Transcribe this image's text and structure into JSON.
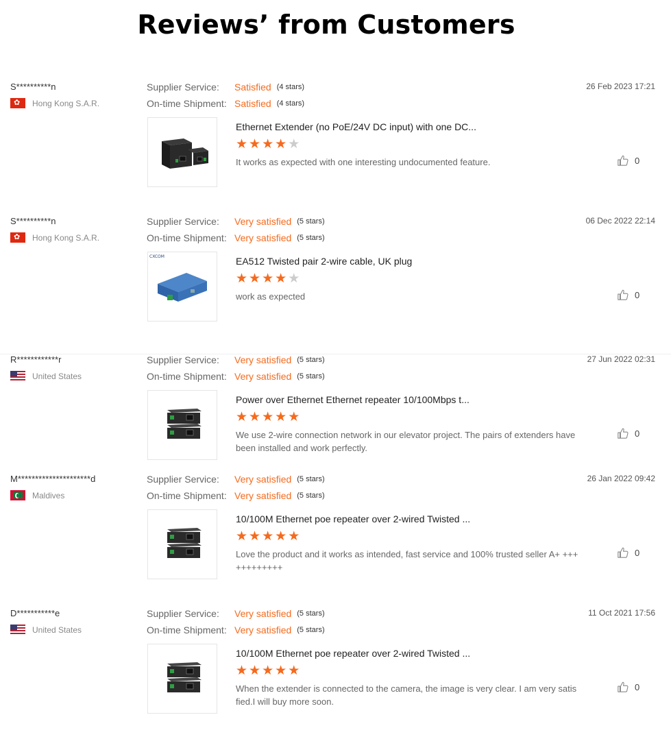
{
  "page_title": "Reviews’ from Customers",
  "labels": {
    "supplier_service": "Supplier Service:",
    "ontime_shipment": "On-time Shipment:"
  },
  "colors": {
    "accent": "#f56a1d",
    "star_off": "#cccccc"
  },
  "reviews": [
    {
      "buyer": "S**********n",
      "country": "Hong Kong S.A.R.",
      "flag_icon": "hong-kong-flag-icon",
      "supplier_service": {
        "value": "Satisfied",
        "stars": "(4 stars)"
      },
      "ontime_shipment": {
        "value": "Satisfied",
        "stars": "(4 stars)"
      },
      "date": "26 Feb 2023 17:21",
      "product_name": "Ethernet Extender (no PoE/24V DC input) with one DC...",
      "rating": 4,
      "comment": "It works as expected with one interesting undocumented feature.",
      "likes": "0",
      "image_icon": "ethernet-extender-image"
    },
    {
      "buyer": "S**********n",
      "country": "Hong Kong S.A.R.",
      "flag_icon": "hong-kong-flag-icon",
      "supplier_service": {
        "value": "Very satisfied",
        "stars": "(5 stars)"
      },
      "ontime_shipment": {
        "value": "Very satisfied",
        "stars": "(5 stars)"
      },
      "date": "06 Dec 2022 22:14",
      "product_name": "EA512 Twisted pair 2-wire cable, UK plug",
      "rating": 4,
      "comment": "work as expected",
      "likes": "0",
      "image_icon": "blue-extender-image",
      "image_brand": "CXCOM"
    },
    {
      "buyer": "R************r",
      "country": "United States",
      "flag_icon": "united-states-flag-icon",
      "supplier_service": {
        "value": "Very satisfied",
        "stars": "(5 stars)"
      },
      "ontime_shipment": {
        "value": "Very satisfied",
        "stars": "(5 stars)"
      },
      "date": "27 Jun 2022 02:31",
      "product_name": "Power over Ethernet Ethernet repeater 10/100Mbps t...",
      "rating": 5,
      "comment": "We use 2-wire connection network in our elevator project. The pairs of extenders have been installed and work perfectly.",
      "likes": "0",
      "image_icon": "stacked-repeater-image"
    },
    {
      "buyer": "M*********************d",
      "country": "Maldives",
      "flag_icon": "maldives-flag-icon",
      "supplier_service": {
        "value": "Very satisfied",
        "stars": "(5 stars)"
      },
      "ontime_shipment": {
        "value": "Very satisfied",
        "stars": "(5 stars)"
      },
      "date": "26 Jan 2022 09:42",
      "product_name": "10/100M Ethernet poe repeater over 2-wired Twisted ...",
      "rating": 5,
      "comment": "Love the product and it works as intended, fast service and 100% trusted seller A+ ++++++++++++",
      "likes": "0",
      "image_icon": "stacked-repeater-image"
    },
    {
      "buyer": "D***********e",
      "country": "United States",
      "flag_icon": "united-states-flag-icon",
      "supplier_service": {
        "value": "Very satisfied",
        "stars": "(5 stars)"
      },
      "ontime_shipment": {
        "value": "Very satisfied",
        "stars": "(5 stars)"
      },
      "date": "11 Oct 2021 17:56",
      "product_name": "10/100M Ethernet poe repeater over 2-wired Twisted ...",
      "rating": 5,
      "comment": "When the extender is connected to the camera, the image is very clear. I am very satisfied.I will buy more soon.",
      "likes": "0",
      "image_icon": "stacked-repeater-image"
    }
  ]
}
